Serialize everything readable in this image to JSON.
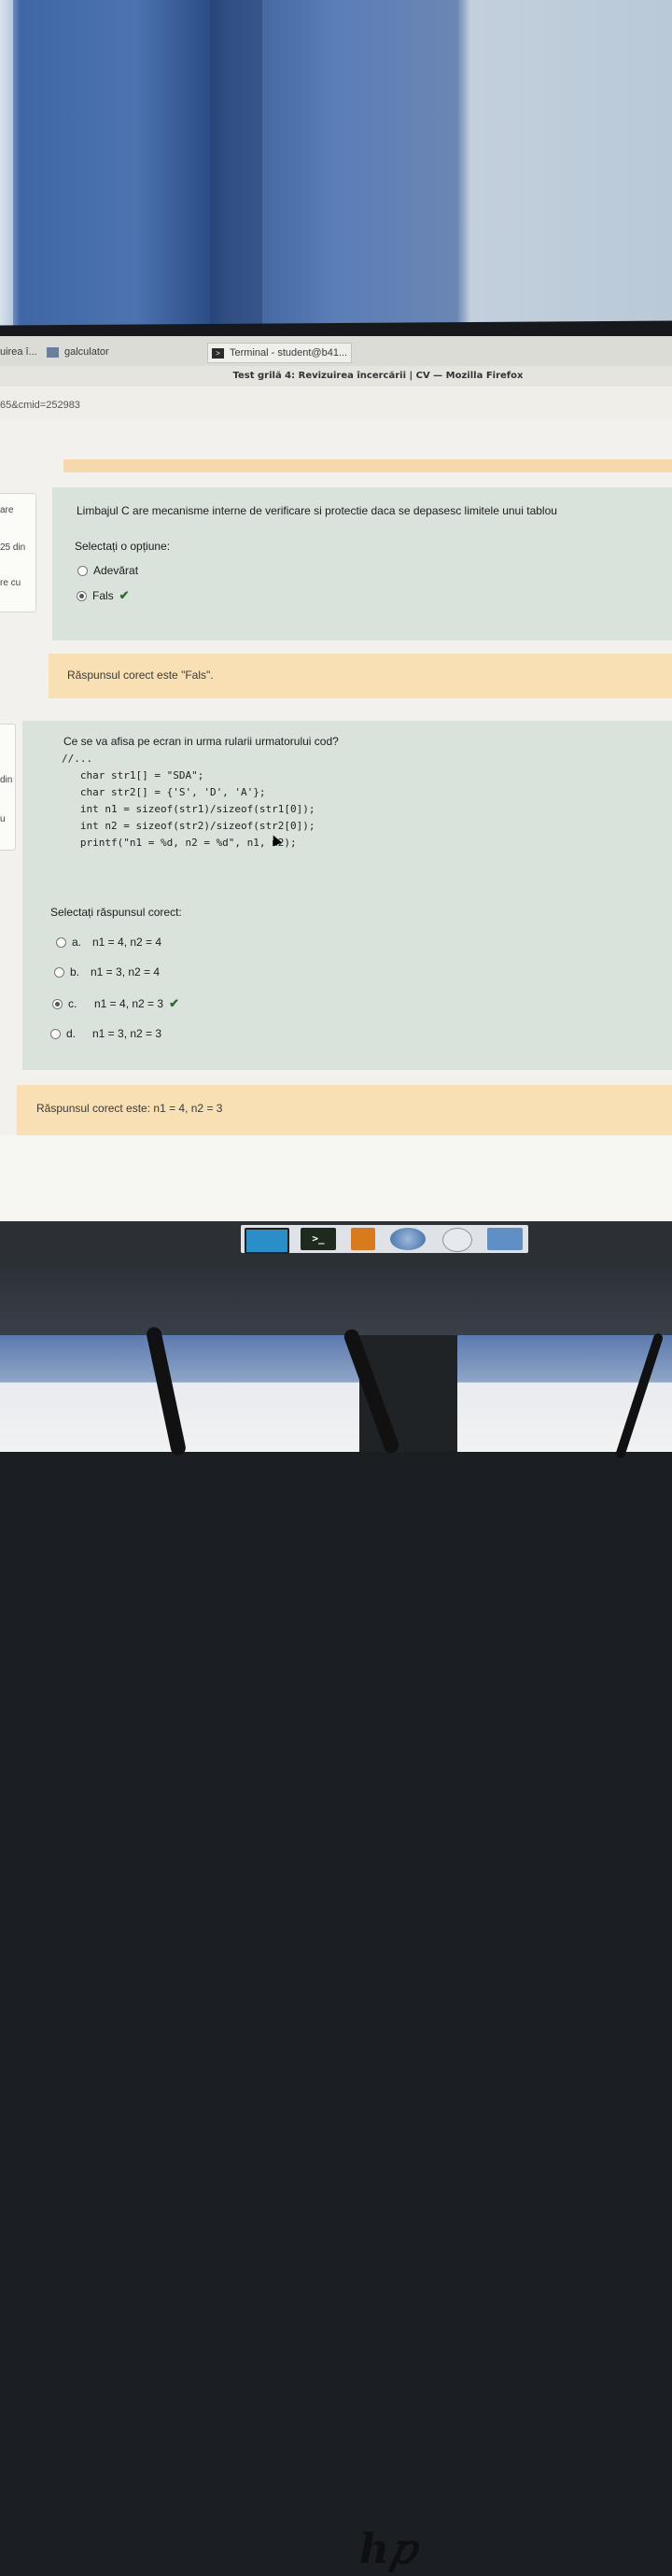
{
  "taskbar": {
    "items": [
      {
        "label": "uirea î..."
      },
      {
        "label": "galculator"
      },
      {
        "label": "Terminal - student@b41..."
      }
    ]
  },
  "window_title": "Test grilă 4: Revizuirea încercării | CV — Mozilla Firefox",
  "url_fragment": "65&cmid=252983",
  "sidebar": {
    "box1": [
      "are",
      "25 din",
      "re cu"
    ],
    "box2": [
      "din",
      "u"
    ]
  },
  "question1": {
    "text": "Limbajul C are mecanisme interne de verificare si protectie daca se depasesc limitele unui tablou",
    "prompt": "Selectați o opțiune:",
    "options": [
      {
        "label": "Adevărat",
        "selected": false,
        "correct": false
      },
      {
        "label": "Fals",
        "selected": true,
        "correct": true
      }
    ],
    "feedback": "Răspunsul corect este \"Fals\"."
  },
  "question2": {
    "text": "Ce se va afisa pe ecran in urma rularii urmatorului cod?",
    "code": [
      "//...",
      "   char str1[] = \"SDA\";",
      "   char str2[] = {'S', 'D', 'A'};",
      "   int n1 = sizeof(str1)/sizeof(str1[0]);",
      "   int n2 = sizeof(str2)/sizeof(str2[0]);",
      "   printf(\"n1 = %d, n2 = %d\", n1, n2);"
    ],
    "prompt": "Selectați răspunsul corect:",
    "options": [
      {
        "letter": "a.",
        "label": "n1 = 4, n2 = 4",
        "selected": false,
        "correct": false
      },
      {
        "letter": "b.",
        "label": "n1 = 3, n2 = 4",
        "selected": false,
        "correct": false
      },
      {
        "letter": "c.",
        "label": "n1 = 4, n2 = 3",
        "selected": true,
        "correct": true
      },
      {
        "letter": "d.",
        "label": "n1 = 3, n2 = 3",
        "selected": false,
        "correct": false
      }
    ],
    "feedback": "Răspunsul corect este: n1 = 4, n2 = 3"
  },
  "colors": {
    "card": "#d9e3dc",
    "feedback": "#f8dfb4",
    "check": "#2f6b2f"
  }
}
